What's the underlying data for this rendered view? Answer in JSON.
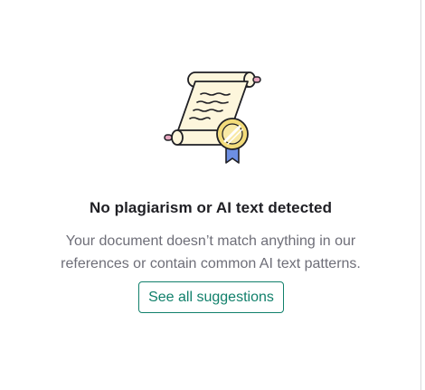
{
  "empty_state": {
    "illustration_icon": "scroll-certificate-icon",
    "title": "No plagiarism or AI text detected",
    "description_line1": "Your document doesn’t match anything in our",
    "description_line2": "references or contain common AI text patterns.",
    "button_label": "See all suggestions"
  },
  "colors": {
    "accent": "#11806b",
    "title": "#1f1f24",
    "description": "#6e6e78",
    "scroll_paper": "#fdf6dc",
    "scroll_handle": "#e8a6c0",
    "seal": "#f3dc7a",
    "ribbon": "#6d8fe3"
  }
}
